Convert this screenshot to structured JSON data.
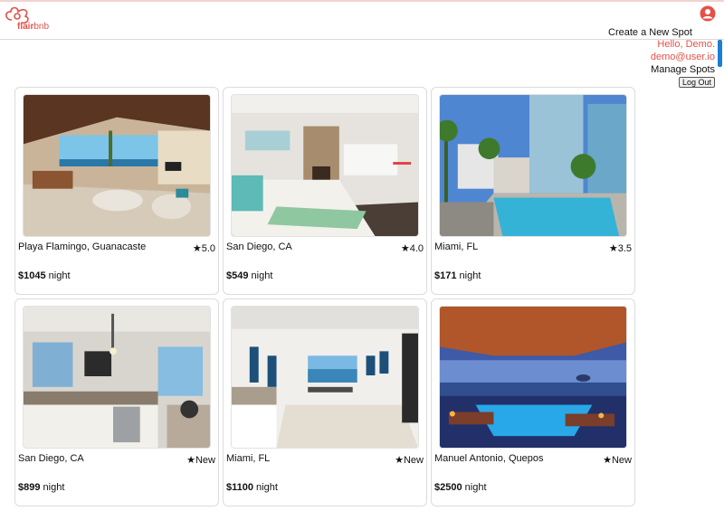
{
  "brand": {
    "name_bold": "flair",
    "name_light": "bnb",
    "logo_color": "#e4514a"
  },
  "header": {
    "create_spot": "Create a New Spot",
    "greeting": "Hello, Demo.",
    "email": "demo@user.io",
    "manage_spots": "Manage Spots",
    "logout": "Log Out"
  },
  "spots": [
    {
      "location": "Playa Flamingo, Guanacaste",
      "rating": "★5.0",
      "price": "$1045",
      "per": " night"
    },
    {
      "location": "San Diego, CA",
      "rating": "★4.0",
      "price": "$549",
      "per": " night"
    },
    {
      "location": "Miami, FL",
      "rating": "★3.5",
      "price": "$171",
      "per": " night"
    },
    {
      "location": "San Diego, CA",
      "rating": "★New",
      "price": "$899",
      "per": " night"
    },
    {
      "location": "Miami, FL",
      "rating": "★New",
      "price": "$1100",
      "per": " night"
    },
    {
      "location": "Manuel Antonio, Quepos",
      "rating": "★New",
      "price": "$2500",
      "per": " night"
    }
  ],
  "colors": {
    "accent": "#e4514a",
    "scroll": "#1a7fd4"
  }
}
